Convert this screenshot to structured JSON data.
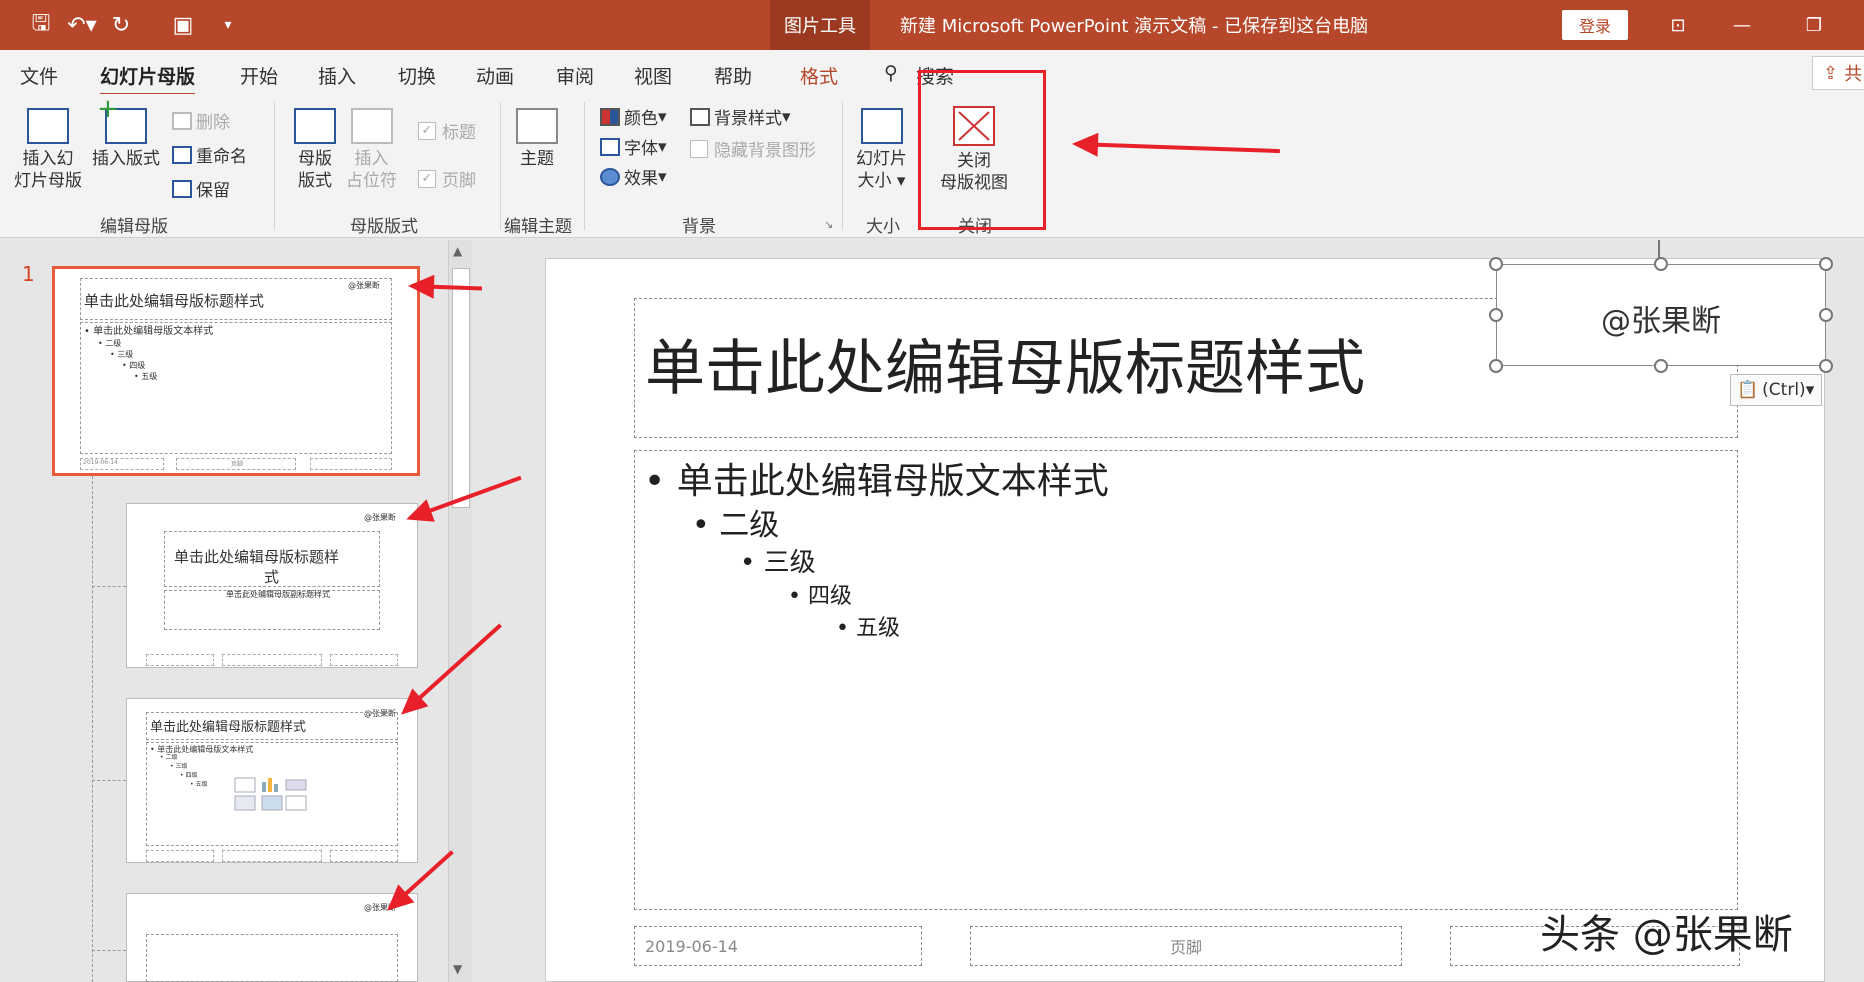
{
  "titlebar": {
    "tools_tag": "图片工具",
    "doc_title": "新建 Microsoft PowerPoint 演示文稿 - 已保存到这台电脑",
    "login": "登录"
  },
  "menu": {
    "tabs": [
      "文件",
      "幻灯片母版",
      "开始",
      "插入",
      "切换",
      "动画",
      "审阅",
      "视图",
      "帮助",
      "格式"
    ],
    "search": "搜索",
    "share": "共"
  },
  "ribbon": {
    "edit_master": {
      "insert_master_l1": "插入幻",
      "insert_master_l2": "灯片母版",
      "insert_layout": "插入版式",
      "delete": "删除",
      "rename": "重命名",
      "preserve": "保留",
      "label": "编辑母版"
    },
    "master_layout": {
      "master_layout_l1": "母版",
      "master_layout_l2": "版式",
      "insert_ph_l1": "插入",
      "insert_ph_l2": "占位符",
      "title": "标题",
      "footer": "页脚",
      "label": "母版版式"
    },
    "edit_theme": {
      "theme": "主题",
      "label": "编辑主题"
    },
    "background": {
      "colors": "颜色",
      "fonts": "字体",
      "effects": "效果",
      "bg_styles": "背景样式",
      "hide_bg": "隐藏背景图形",
      "label": "背景"
    },
    "size": {
      "slide_size_l1": "幻灯片",
      "slide_size_l2": "大小",
      "label": "大小"
    },
    "close": {
      "close_l1": "关闭",
      "close_l2": "母版视图",
      "label": "关闭"
    }
  },
  "thumbs": {
    "num": "1",
    "title": "单击此处编辑母版标题样式",
    "text": "单击此处编辑母版文本样式",
    "levels": [
      "二级",
      "三级",
      "四级",
      "五级"
    ],
    "wm": "@张果断",
    "t2_title": "单击此处编辑母版标题样",
    "t2_title2": "式",
    "t2_sub": "单击此处编辑母版副标题样式",
    "date": "2019-06-14",
    "footer": "页脚"
  },
  "slide": {
    "title": "单击此处编辑母版标题样式",
    "body": "单击此处编辑母版文本样式",
    "level2": "二级",
    "level3": "三级",
    "level4": "四级",
    "level5": "五级",
    "watermark": "@张果断",
    "paste_ctrl": "(Ctrl)",
    "date": "2019-06-14",
    "footer": "页脚"
  },
  "corner_watermark": "头条 @张果断",
  "colors": {
    "accent": "#b7472a",
    "highlight": "#e8202a"
  }
}
